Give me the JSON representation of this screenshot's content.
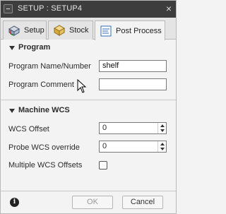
{
  "window": {
    "title": "SETUP : SETUP4",
    "close_glyph": "×"
  },
  "tabs": [
    {
      "label": "Setup",
      "icon": "setup-icon",
      "active": false
    },
    {
      "label": "Stock",
      "icon": "stock-icon",
      "active": false
    },
    {
      "label": "Post Process",
      "icon": "post-process-icon",
      "active": true
    }
  ],
  "program_section": {
    "title": "Program",
    "fields": [
      {
        "label": "Program Name/Number",
        "value": "shelf"
      },
      {
        "label": "Program Comment",
        "value": ""
      }
    ]
  },
  "machine_wcs_section": {
    "title": "Machine WCS",
    "wcs_offset": {
      "label": "WCS Offset",
      "value": "0"
    },
    "probe_wcs_override": {
      "label": "Probe WCS override",
      "value": "0"
    },
    "multiple_wcs_offsets": {
      "label": "Multiple WCS Offsets",
      "checked": false
    }
  },
  "footer": {
    "ok_label": "OK",
    "cancel_label": "Cancel",
    "info_glyph": "i"
  }
}
